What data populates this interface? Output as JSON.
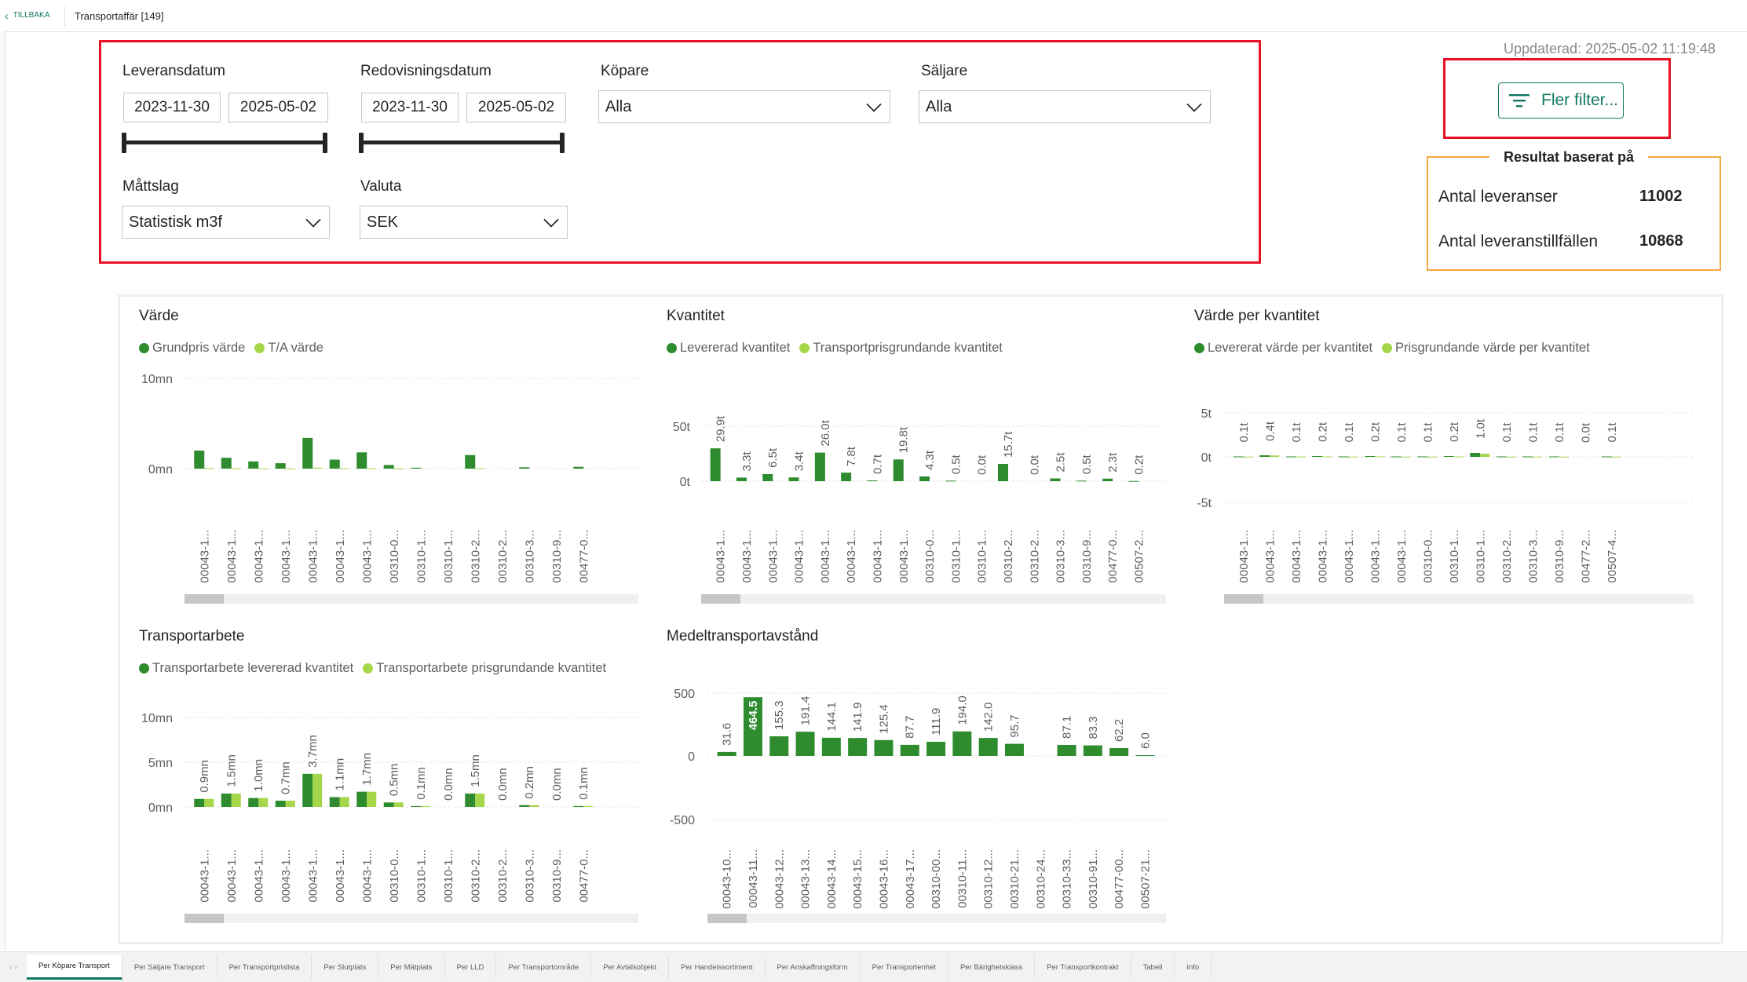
{
  "header": {
    "back_label": "TILLBAKA",
    "title": "Transportaffär [149]"
  },
  "updated_text": "Uppdaterad: 2025-05-02 11:19:48",
  "filters": {
    "leveransdatum": {
      "label": "Leveransdatum",
      "from": "2023-11-30",
      "to": "2025-05-02"
    },
    "redovisningsdatum": {
      "label": "Redovisningsdatum",
      "from": "2023-11-30",
      "to": "2025-05-02"
    },
    "kopare": {
      "label": "Köpare",
      "value": "Alla"
    },
    "saljare": {
      "label": "Säljare",
      "value": "Alla"
    },
    "mattslag": {
      "label": "Måttslag",
      "value": "Statistisk m3f"
    },
    "valuta": {
      "label": "Valuta",
      "value": "SEK"
    },
    "more_filters_label": "Fler filter..."
  },
  "results": {
    "title": "Resultat baserat på",
    "rows": [
      {
        "label": "Antal leveranser",
        "value": "11002"
      },
      {
        "label": "Antal leveranstillfällen",
        "value": "10868"
      }
    ]
  },
  "colors": {
    "dark_green": "#2e8b2e",
    "light_green": "#a6d64a",
    "accent": "#117865",
    "red": "#e81123",
    "orange": "#f7a840"
  },
  "tabs": [
    "Per Köpare Transport",
    "Per Säljare Transport",
    "Per Transportprislista",
    "Per Slutplats",
    "Per Mätplats",
    "Per LLD",
    "Per Transportområde",
    "Per Avtalsobjekt",
    "Per Handelssortiment",
    "Per Anskaffningsform",
    "Per Transportenhet",
    "Per Bärighetsklass",
    "Per Transportkontrakt",
    "Tabell",
    "Info"
  ],
  "active_tab": 0,
  "chart_data": [
    {
      "id": "varde",
      "type": "bar",
      "title": "Värde",
      "series": [
        {
          "name": "Grundpris värde",
          "values": [
            2.0,
            1.2,
            0.8,
            0.6,
            3.4,
            1.0,
            1.8,
            0.4,
            0.1,
            0,
            1.5,
            0,
            0.15,
            0,
            0.2
          ]
        },
        {
          "name": "T/A värde",
          "values": [
            0.05,
            0.03,
            0.02,
            0.02,
            0.1,
            0.03,
            0.05,
            0.01,
            0,
            0,
            0.04,
            0,
            0,
            0,
            0
          ]
        }
      ],
      "categories": [
        "00043-1...",
        "00043-1...",
        "00043-1...",
        "00043-1...",
        "00043-1...",
        "00043-1...",
        "00043-1...",
        "00310-0...",
        "00310-1...",
        "00310-1...",
        "00310-2...",
        "00310-2...",
        "00310-3...",
        "00310-9...",
        "00477-0..."
      ],
      "y_ticks": [
        "10mn",
        "0mn"
      ],
      "ylim": [
        0,
        10
      ],
      "data_labels": []
    },
    {
      "id": "kvantitet",
      "type": "bar",
      "title": "Kvantitet",
      "series": [
        {
          "name": "Levererad kvantitet",
          "values": [
            29.9,
            3.3,
            6.5,
            3.4,
            26.0,
            7.8,
            0.7,
            19.8,
            4.3,
            0.5,
            0.0,
            15.7,
            0.0,
            2.5,
            0.5,
            2.3,
            0.2
          ]
        },
        {
          "name": "Transportprisgrundande kvantitet",
          "values": [
            0,
            0,
            0,
            0,
            0,
            0,
            0,
            0,
            0,
            0,
            0,
            0,
            0,
            0,
            0,
            0,
            0
          ]
        }
      ],
      "categories": [
        "00043-1...",
        "00043-1...",
        "00043-1...",
        "00043-1...",
        "00043-1...",
        "00043-1...",
        "00043-1...",
        "00043-1...",
        "00310-0...",
        "00310-1...",
        "00310-1...",
        "00310-2...",
        "00310-2...",
        "00310-3...",
        "00310-9...",
        "00477-0...",
        "00507-2..."
      ],
      "y_ticks": [
        "50t",
        "0t"
      ],
      "ylim": [
        0,
        50
      ],
      "data_labels": [
        "29.9t",
        "3.3t",
        "6.5t",
        "3.4t",
        "26.0t",
        "7.8t",
        "0.7t",
        "19.8t",
        "4.3t",
        "0.5t",
        "0.0t",
        "15.7t",
        "0.0t",
        "2.5t",
        "0.5t",
        "2.3t",
        "0.2t"
      ]
    },
    {
      "id": "varde_per_kvantitet",
      "type": "bar",
      "title": "Värde per kvantitet",
      "series": [
        {
          "name": "Levererat värde per kvantitet",
          "values": [
            0.1,
            0.4,
            0.1,
            0.2,
            0.1,
            0.2,
            0.1,
            0.1,
            0.2,
            1.0,
            0.1,
            0.1,
            0.1,
            0.0,
            0.1
          ]
        },
        {
          "name": "Prisgrundande värde per kvantitet",
          "values": [
            0.05,
            0.35,
            0.08,
            0.1,
            0.05,
            0.1,
            0.05,
            0.05,
            0.1,
            0.8,
            0.05,
            0.05,
            0.05,
            0,
            0.05
          ]
        }
      ],
      "categories": [
        "00043-1...",
        "00043-1...",
        "00043-1...",
        "00043-1...",
        "00043-1...",
        "00043-1...",
        "00043-1...",
        "00310-0...",
        "00310-1...",
        "00310-1...",
        "00310-2...",
        "00310-3...",
        "00310-9...",
        "00477-2...",
        "00507-4..."
      ],
      "y_ticks": [
        "5t",
        "0t",
        "-5t"
      ],
      "ylim": [
        -5,
        5
      ],
      "data_labels": [
        "0.1t",
        "0.4t",
        "0.1t",
        "0.2t",
        "0.1t",
        "0.2t",
        "0.1t",
        "0.1t",
        "0.2t",
        "1.0t",
        "0.1t",
        "0.1t",
        "0.1t",
        "0.0t",
        "0.1t"
      ]
    },
    {
      "id": "transportarbete",
      "type": "bar",
      "title": "Transportarbete",
      "series": [
        {
          "name": "Transportarbete levererad kvantitet",
          "values": [
            0.9,
            1.5,
            1.0,
            0.7,
            3.7,
            1.1,
            1.7,
            0.5,
            0.1,
            0.0,
            1.5,
            0.0,
            0.2,
            0.0,
            0.1
          ]
        },
        {
          "name": "Transportarbete prisgrundande kvantitet",
          "values": [
            0.9,
            1.5,
            1.0,
            0.7,
            3.7,
            1.1,
            1.7,
            0.5,
            0.1,
            0.0,
            1.5,
            0.0,
            0.2,
            0.0,
            0.1
          ]
        }
      ],
      "categories": [
        "00043-1...",
        "00043-1...",
        "00043-1...",
        "00043-1...",
        "00043-1...",
        "00043-1...",
        "00043-1...",
        "00310-0...",
        "00310-1...",
        "00310-1...",
        "00310-2...",
        "00310-2...",
        "00310-3...",
        "00310-9...",
        "00477-0..."
      ],
      "y_ticks": [
        "10mn",
        "5mn",
        "0mn"
      ],
      "ylim": [
        0,
        10
      ],
      "data_labels": [
        "0.9mn",
        "1.5mn",
        "1.0mn",
        "0.7mn",
        "3.7mn",
        "1.1mn",
        "1.7mn",
        "0.5mn",
        "0.1mn",
        "0.0mn",
        "1.5mn",
        "0.0mn",
        "0.2mn",
        "0.0mn",
        "0.1mn"
      ]
    },
    {
      "id": "medeltransportavstand",
      "type": "bar",
      "title": "Medeltransportavstånd",
      "series": [
        {
          "name": "",
          "values": [
            31.6,
            464.5,
            155.3,
            191.4,
            144.1,
            141.9,
            125.4,
            87.7,
            111.9,
            194.0,
            142.0,
            95.7,
            0,
            87.1,
            83.3,
            62.2,
            6.0
          ]
        }
      ],
      "categories": [
        "00043-10...",
        "00043-11...",
        "00043-12...",
        "00043-13...",
        "00043-14...",
        "00043-15...",
        "00043-16...",
        "00043-17...",
        "00310-00...",
        "00310-11...",
        "00310-12...",
        "00310-21...",
        "00310-24...",
        "00310-33...",
        "00310-91...",
        "00477-00...",
        "00507-21..."
      ],
      "y_ticks": [
        "500",
        "0",
        "-500"
      ],
      "ylim": [
        -500,
        500
      ],
      "data_labels": [
        "31.6",
        "464.5",
        "155.3",
        "191.4",
        "144.1",
        "141.9",
        "125.4",
        "87.7",
        "111.9",
        "194.0",
        "142.0",
        "95.7",
        "",
        "87.1",
        "83.3",
        "62.2",
        "6.0"
      ]
    }
  ]
}
